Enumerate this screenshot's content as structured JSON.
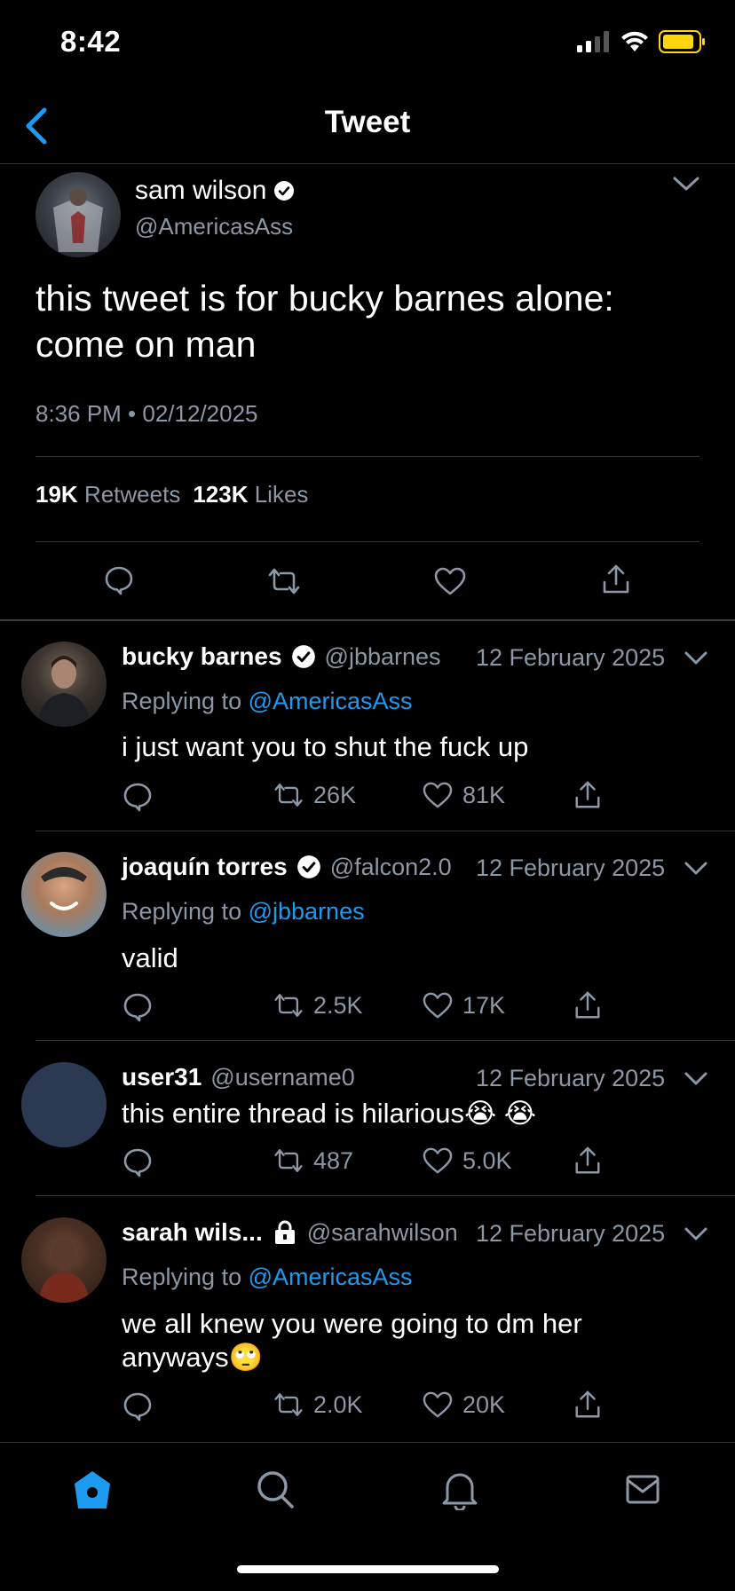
{
  "status_bar": {
    "time": "8:42"
  },
  "header": {
    "title": "Tweet"
  },
  "main_tweet": {
    "name": "sam wilson",
    "handle": "@AmericasAss",
    "text_line1": "this tweet is for bucky barnes alone:",
    "text_line2": "come on man",
    "timestamp": "8:36 PM • 02/12/2025",
    "retweets_count": "19K",
    "retweets_label": "Retweets",
    "likes_count": "123K",
    "likes_label": "Likes"
  },
  "replies": [
    {
      "name": "bucky barnes",
      "handle": "@jbbarnes",
      "date": "12 February 2025",
      "replying_label": "Replying to",
      "replying_to": "@AmericasAss",
      "text": "i just want you to shut the fuck up",
      "retweets": "26K",
      "likes": "81K"
    },
    {
      "name": "joaquín torres",
      "handle": "@falcon2.0",
      "date": "12 February 2025",
      "replying_label": "Replying to",
      "replying_to": "@jbbarnes",
      "text": "valid",
      "retweets": "2.5K",
      "likes": "17K"
    },
    {
      "name": "user31",
      "handle": "@username0",
      "date": "12 February 2025",
      "text": "this entire thread is hilarious😭 😭",
      "retweets": "487",
      "likes": "5.0K"
    },
    {
      "name": "sarah wils...",
      "handle": "@sarahwilson",
      "date": "12 February 2025",
      "replying_label": "Replying to",
      "replying_to": "@AmericasAss",
      "text_line1": "we all knew you were going to dm her",
      "text_line2": "anyways🙄",
      "retweets": "2.0K",
      "likes": "20K"
    }
  ],
  "colors": {
    "accent": "#1d9bf0",
    "muted": "#8b98a5",
    "divider": "#2f3336",
    "battery": "#ffd60a"
  },
  "icons": [
    "back-chevron-icon",
    "verified-icon",
    "chevron-down-icon",
    "reply-icon",
    "retweet-icon",
    "like-icon",
    "share-icon",
    "lock-icon",
    "home-icon",
    "search-icon",
    "notifications-icon",
    "messages-icon"
  ]
}
